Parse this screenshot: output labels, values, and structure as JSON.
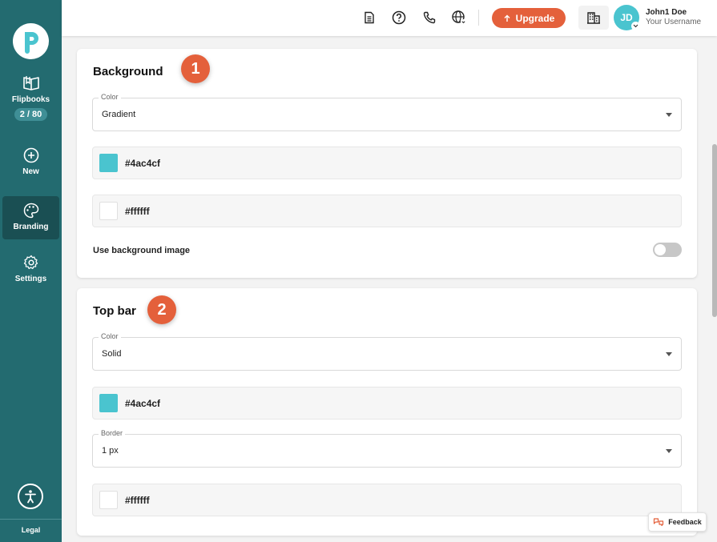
{
  "sidebar": {
    "items": [
      {
        "label": "Flipbooks",
        "count": "2 / 80",
        "icon": "book-icon"
      },
      {
        "label": "New",
        "icon": "plus-circle-icon"
      },
      {
        "label": "Branding",
        "icon": "palette-icon",
        "active": true
      },
      {
        "label": "Settings",
        "icon": "gear-icon"
      }
    ],
    "legal": "Legal"
  },
  "header": {
    "upgrade_label": "Upgrade",
    "avatar_initials": "JD",
    "user_name": "John1 Doe",
    "user_sub": "Your Username"
  },
  "background": {
    "title": "Background",
    "step": "1",
    "color_field_label": "Color",
    "color_value": "Gradient",
    "color1": "#4ac4cf",
    "color2": "#ffffff",
    "use_image_label": "Use background image",
    "use_image_enabled": false
  },
  "topbar": {
    "title": "Top bar",
    "step": "2",
    "color_field_label": "Color",
    "color_value": "Solid",
    "color1": "#4ac4cf",
    "border_field_label": "Border",
    "border_value": "1 px",
    "border_color": "#ffffff"
  },
  "feedback_label": "Feedback",
  "colors": {
    "sidebar": "#236b70",
    "accent": "#e4603b",
    "brand_teal": "#4ac4cf"
  }
}
